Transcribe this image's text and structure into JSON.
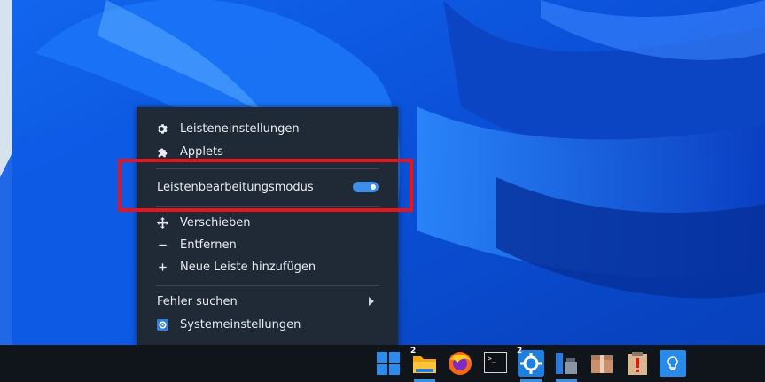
{
  "context_menu": {
    "items": [
      {
        "label": "Leisteneinstellungen",
        "icon": "gear-icon"
      },
      {
        "label": "Applets",
        "icon": "puzzle-icon"
      },
      {
        "label": "Leistenbearbeitungsmodus",
        "toggle": true
      },
      {
        "label": "Verschieben",
        "icon": "move-icon"
      },
      {
        "label": "Entfernen",
        "icon": "minus-icon"
      },
      {
        "label": "Neue Leiste hinzufügen",
        "icon": "plus-icon"
      },
      {
        "label": "Fehler suchen",
        "submenu": true
      },
      {
        "label": "Systemeinstellungen",
        "icon": "settings-app-icon"
      }
    ],
    "toggle_state": "on"
  },
  "taskbar": {
    "apps": [
      {
        "name": "start-menu-icon"
      },
      {
        "name": "file-manager-icon",
        "badge": "2"
      },
      {
        "name": "firefox-icon"
      },
      {
        "name": "terminal-icon",
        "glyph": ">_"
      },
      {
        "name": "system-settings-icon",
        "badge": "2"
      },
      {
        "name": "software-manager-icon"
      },
      {
        "name": "archive-manager-icon"
      },
      {
        "name": "update-manager-icon"
      },
      {
        "name": "light-bulb-icon"
      }
    ]
  },
  "colors": {
    "menu_bg": "#1f2a36",
    "accent": "#3d8ee8",
    "highlight": "#e8141c",
    "taskbar_bg": "#10151c"
  }
}
